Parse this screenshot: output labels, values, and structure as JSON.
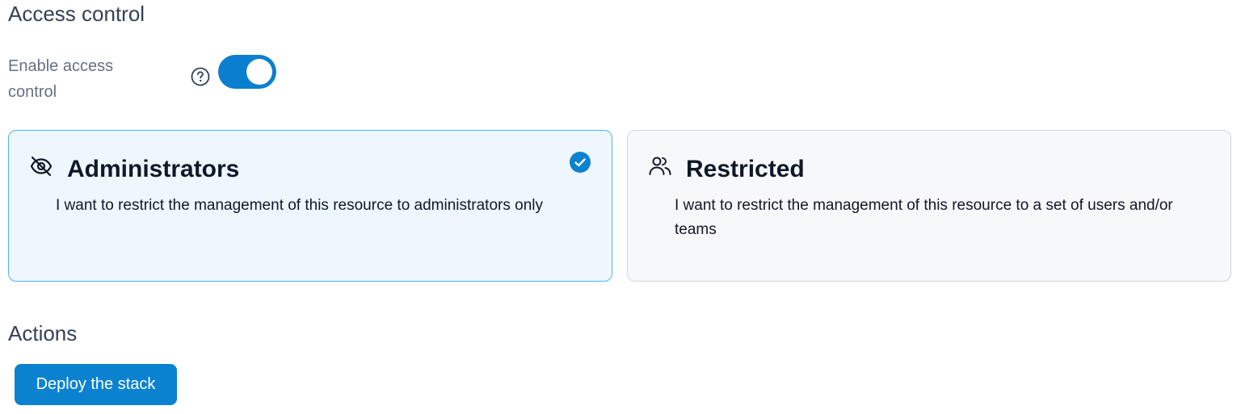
{
  "access_control": {
    "section_title": "Access control",
    "toggle": {
      "label": "Enable access control",
      "enabled": true,
      "help_icon": "question-circle-icon"
    },
    "options": {
      "administrators": {
        "title": "Administrators",
        "description": "I want to restrict the management of this resource to administrators only",
        "icon": "eye-off-icon",
        "selected": true
      },
      "restricted": {
        "title": "Restricted",
        "description": "I want to restrict the management of this resource to a set of users and/or teams",
        "icon": "users-icon",
        "selected": false
      }
    }
  },
  "actions": {
    "section_title": "Actions",
    "deploy_label": "Deploy the stack"
  },
  "colors": {
    "accent": "#0b82cf",
    "selected_card_bg": "#eef7fe",
    "selected_card_border": "#4cb8ea",
    "card_bg": "#f7f8fa",
    "card_border": "#d0d5dd"
  }
}
